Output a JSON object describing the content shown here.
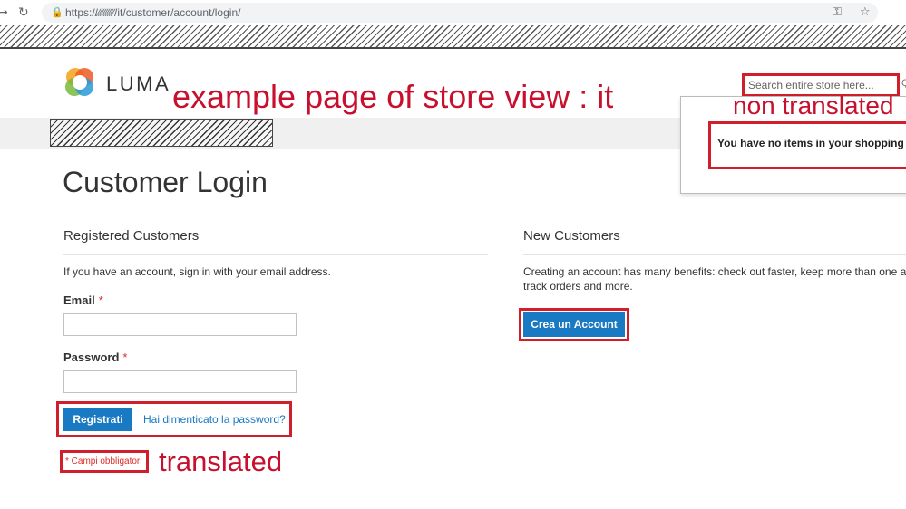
{
  "browser": {
    "back_icon": "back-arrow-icon",
    "reload_icon": "reload-icon",
    "url": "https://∕∕∕∕∕∕∕∕∕/it/customer/account/login/",
    "key_icon": "key-icon",
    "star_icon": "star-icon"
  },
  "header": {
    "logo_text": "LUMA",
    "search_placeholder": "Search entire store here...",
    "minicart_message": "You have no items in your shopping cart."
  },
  "annotations": {
    "store_view": "example page of store view : it",
    "non_translated": "non translated",
    "translated": "translated"
  },
  "page": {
    "title": "Customer Login",
    "registered": {
      "title": "Registered Customers",
      "intro": "If you have an account, sign in with your email address.",
      "email_label": "Email",
      "password_label": "Password",
      "required_mark": "*",
      "signin_button": "Registrati",
      "forgot_link": "Hai dimenticato la password?",
      "required_note": "* Campi obbligatori"
    },
    "new_customers": {
      "title": "New Customers",
      "intro_line1": "Creating an account has many benefits: check out faster, keep more than one address,",
      "intro_line2": "track orders and more.",
      "create_button": "Crea un Account"
    }
  },
  "colors": {
    "annotation_red": "#c8102e",
    "button_blue": "#1979c3",
    "required_red": "#e02b27"
  }
}
